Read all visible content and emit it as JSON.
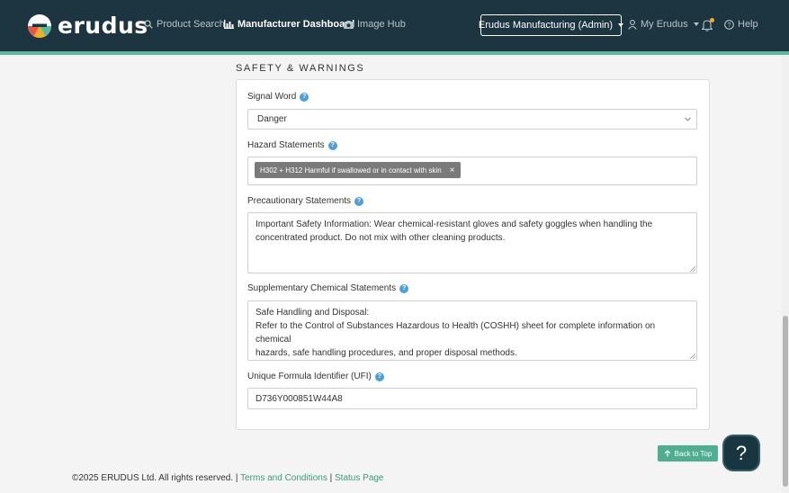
{
  "brand": {
    "name": "erudus"
  },
  "nav": {
    "product_search": "Product Search",
    "manufacturer_dashboard": "Manufacturer Dashboard",
    "image_hub": "Image Hub",
    "account_switcher": "Erudus Manufacturing (Admin)",
    "my_erudus": "My Erudus",
    "help": "Help"
  },
  "section": {
    "title": "SAFETY & WARNINGS",
    "signal_word": {
      "label": "Signal Word",
      "value": "Danger"
    },
    "hazard_statements": {
      "label": "Hazard Statements",
      "tags": [
        "H302 + H312 Harmful if swallowed or in contact with skin"
      ]
    },
    "precautionary_statements": {
      "label": "Precautionary Statements",
      "lines": [
        "Important Safety Information: Wear chemical-resistant gloves and safety goggles when handling the",
        "concentrated product. Do not mix with other cleaning products."
      ]
    },
    "supplementary_statements": {
      "label": "Supplementary Chemical Statements",
      "lines": [
        "Safe Handling and Disposal:",
        "Refer to the Control of Substances Hazardous to Health (COSHH) sheet for complete information on chemical",
        "hazards, safe handling procedures, and proper disposal methods."
      ]
    },
    "ufi": {
      "label": "Unique Formula Identifier (UFI)",
      "value": "D736Y000851W44A8"
    }
  },
  "back_to_top": "Back to Top",
  "help_fab": "?",
  "footer": {
    "copyright": "©2025 ERUDUS Ltd. All rights reserved.",
    "sep": "|",
    "terms": "Terms and Conditions",
    "status": "Status Page"
  },
  "colors": {
    "navbar": "#1d3540",
    "accent": "#5cb89a",
    "help_blue": "#4f9ed6",
    "link": "#3c9a7e",
    "tag": "#7a7a7a"
  }
}
